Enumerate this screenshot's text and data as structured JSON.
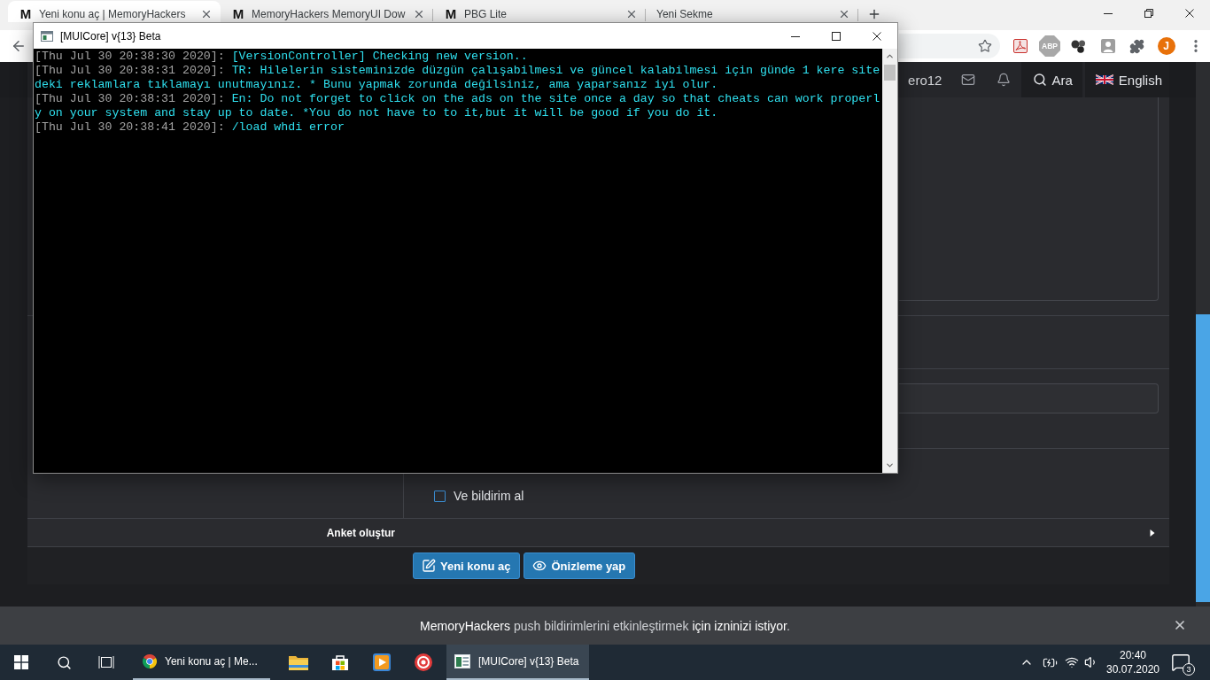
{
  "browser": {
    "tabs": [
      {
        "title": "Yeni konu aç | MemoryHackers",
        "favicon_letter": "M",
        "selected": true
      },
      {
        "title": "MemoryHackers MemoryUI Dow",
        "favicon_letter": "M",
        "selected": false
      },
      {
        "title": "PBG Lite",
        "favicon_letter": "M",
        "selected": false
      },
      {
        "title": "Yeni Sekme",
        "selected": false
      }
    ],
    "toolbar": {
      "adblock_badge": "ABP",
      "profile_initial": "J"
    }
  },
  "site_nav": {
    "username": "ero12",
    "search_label": "Ara",
    "language": "English"
  },
  "form": {
    "options": [
      {
        "label": "Ve bildirim al",
        "checked": false
      }
    ],
    "poll": {
      "label": "Anket oluştur",
      "expanded": false
    },
    "buttons": [
      {
        "label": "Yeni konu aç",
        "kind": "submit"
      },
      {
        "label": "Önizleme yap",
        "kind": "preview"
      }
    ]
  },
  "push_prompt": {
    "message": "**MemoryHackers** push bildirimlerini etkinleştirmek **için izninizi istiyor**."
  },
  "console_window": {
    "title": "[MUICore] v{13} Beta",
    "lines": [
      {
        "timestamp": "[Thu Jul 30 20:38:30 2020]:",
        "message": "[VersionController] Checking new version.."
      },
      {
        "timestamp": "[Thu Jul 30 20:38:31 2020]:",
        "message": "TR: Hilelerin sisteminizde düzgün çalışabilmesi ve güncel kalabilmesi için günde 1 kere sitedeki reklamlara tıklamayı unutmayınız. * Bunu yapmak zorunda değilsiniz, ama yaparsanız iyi olur."
      },
      {
        "timestamp": "[Thu Jul 30 20:38:31 2020]:",
        "message": "En: Do not forget to click on the ads on the site once a day so that cheats can work properly on your system and stay up to date. *You do not have to to it,but it will be good if you do it."
      },
      {
        "timestamp": "[Thu Jul 30 20:38:41 2020]:",
        "message": "/load whdi error"
      }
    ]
  },
  "taskbar": {
    "windows": [
      {
        "label": "Yeni konu aç | Me...",
        "kind": "browser",
        "selected": false
      },
      {
        "label": "[MUICore] v{13} Beta",
        "kind": "console",
        "selected": true
      }
    ],
    "clock": {
      "time": "20:40",
      "date": "30.07.2020"
    },
    "notification_count": "3"
  }
}
